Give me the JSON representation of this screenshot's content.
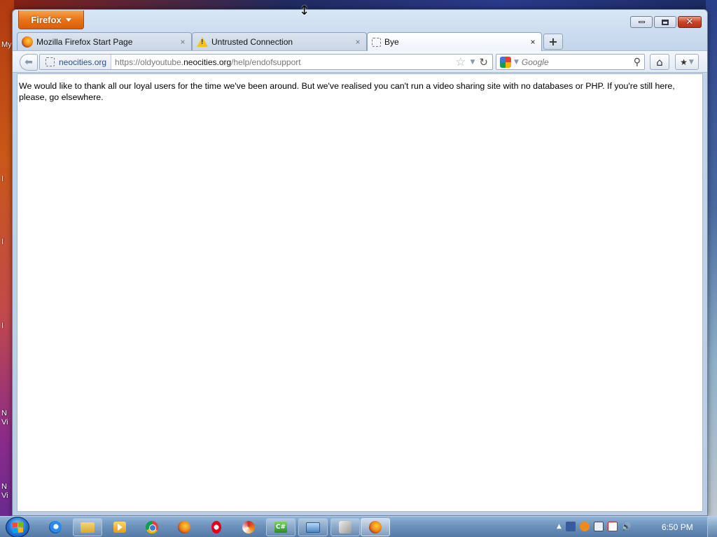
{
  "desktop": {
    "icon_labels": [
      "My",
      "I",
      "I",
      "I",
      "N",
      "Vi",
      "N",
      "Vi"
    ]
  },
  "browser": {
    "menu_button": "Firefox",
    "tabs": [
      {
        "title": "Mozilla Firefox Start Page",
        "icon": "firefox-icon",
        "active": false
      },
      {
        "title": "Untrusted Connection",
        "icon": "warning-icon",
        "active": false
      },
      {
        "title": "Bye",
        "icon": "blank-page-icon",
        "active": true
      }
    ],
    "new_tab_label": "+",
    "tab_close_glyph": "×",
    "identity_label": "neocities.org",
    "url_prefix": "https://oldyoutube.",
    "url_domain": "neocities.org",
    "url_path": "/help/endofsupport",
    "search_engine": "Google",
    "search_placeholder": "Google"
  },
  "page": {
    "body_text": "We would like to thank all our loyal users for the time we've been around. But we've realised you can't run a video sharing site with no databases or PHP. If you're still here, please, go elsewhere."
  },
  "taskbar": {
    "apps": [
      "internet-explorer",
      "windows-explorer",
      "media-player",
      "chrome",
      "firefox",
      "opera",
      "swirl-app",
      "csharp-ide",
      "virtual-machine",
      "tool-app",
      "firefox-active"
    ],
    "clock": "6:50 PM"
  },
  "colors": {
    "firefox_orange": "#e8741a",
    "taskbar_blue": "#6c92bb",
    "window_frame": "#c3d5ea"
  }
}
